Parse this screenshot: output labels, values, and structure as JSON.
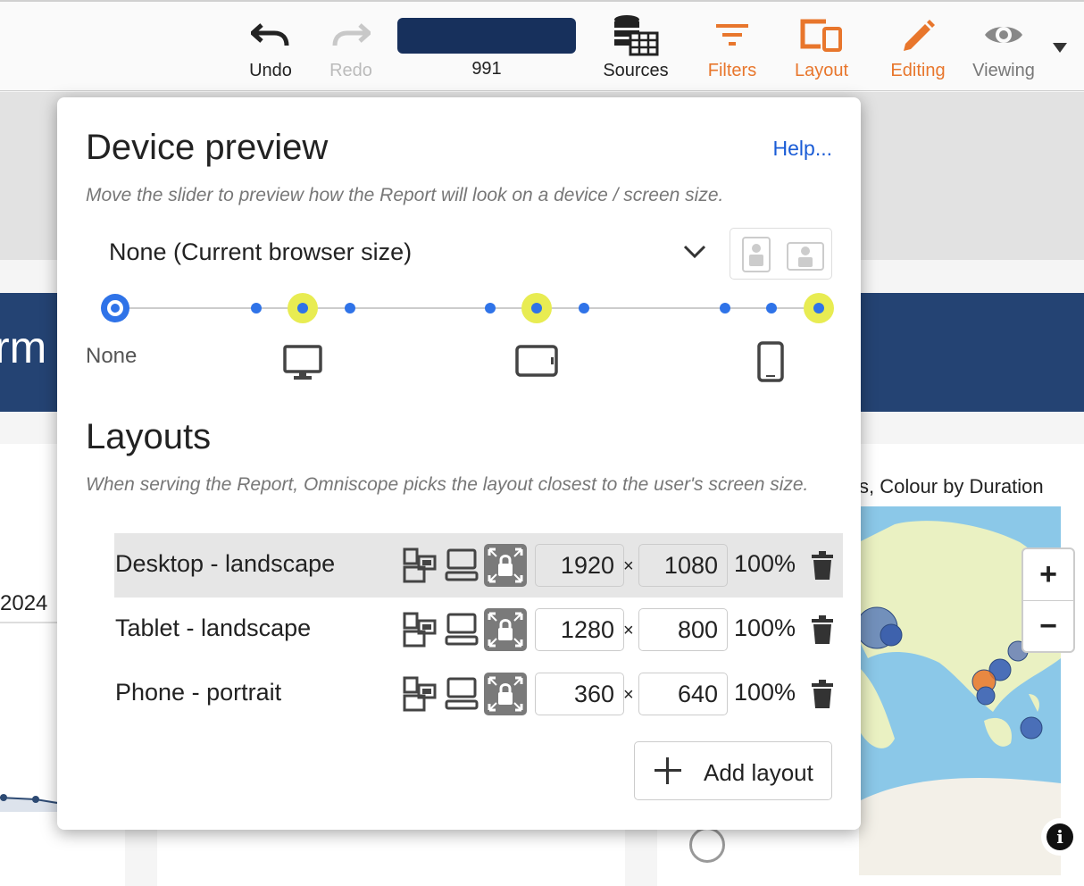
{
  "toolbar": {
    "undo_label": "Undo",
    "redo_label": "Redo",
    "report_subtitle": "991",
    "sources_label": "Sources",
    "filters_label": "Filters",
    "layout_label": "Layout",
    "editing_label": "Editing",
    "viewing_label": "Viewing"
  },
  "background": {
    "title_fragment": "rm",
    "year_label": "2024",
    "map_caption": "s, Colour by Duration"
  },
  "device_preview": {
    "title": "Device preview",
    "help_label": "Help...",
    "description": "Move the slider to preview how the Report will look on a device / screen size.",
    "selected_device": "None (Current browser size)",
    "slider_none_label": "None"
  },
  "layouts": {
    "title": "Layouts",
    "description": "When serving the Report, Omniscope picks the layout closest to the user's screen size.",
    "times_symbol": "×",
    "rows": [
      {
        "name": "Desktop - landscape",
        "width": "1920",
        "height": "1080",
        "scale": "100%"
      },
      {
        "name": "Tablet - landscape",
        "width": "1280",
        "height": "800",
        "scale": "100%"
      },
      {
        "name": "Phone - portrait",
        "width": "360",
        "height": "640",
        "scale": "100%"
      }
    ],
    "add_label": "Add layout"
  },
  "colors": {
    "accent_orange": "#e8762c",
    "brand_navy": "#17305c",
    "link_blue": "#1a5cd6",
    "slider_blue": "#2f73e8",
    "slider_highlight": "#e8ec52"
  }
}
